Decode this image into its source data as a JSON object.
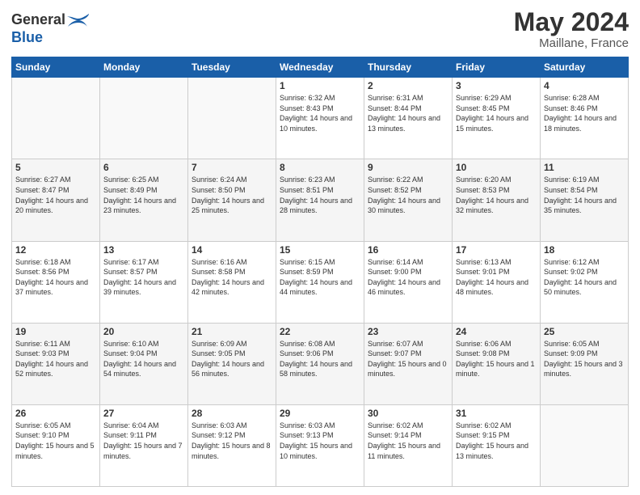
{
  "header": {
    "logo_line1": "General",
    "logo_line2": "Blue",
    "month_year": "May 2024",
    "location": "Maillane, France"
  },
  "days_of_week": [
    "Sunday",
    "Monday",
    "Tuesday",
    "Wednesday",
    "Thursday",
    "Friday",
    "Saturday"
  ],
  "weeks": [
    [
      {
        "day": "",
        "sunrise": "",
        "sunset": "",
        "daylight": ""
      },
      {
        "day": "",
        "sunrise": "",
        "sunset": "",
        "daylight": ""
      },
      {
        "day": "",
        "sunrise": "",
        "sunset": "",
        "daylight": ""
      },
      {
        "day": "1",
        "sunrise": "Sunrise: 6:32 AM",
        "sunset": "Sunset: 8:43 PM",
        "daylight": "Daylight: 14 hours and 10 minutes."
      },
      {
        "day": "2",
        "sunrise": "Sunrise: 6:31 AM",
        "sunset": "Sunset: 8:44 PM",
        "daylight": "Daylight: 14 hours and 13 minutes."
      },
      {
        "day": "3",
        "sunrise": "Sunrise: 6:29 AM",
        "sunset": "Sunset: 8:45 PM",
        "daylight": "Daylight: 14 hours and 15 minutes."
      },
      {
        "day": "4",
        "sunrise": "Sunrise: 6:28 AM",
        "sunset": "Sunset: 8:46 PM",
        "daylight": "Daylight: 14 hours and 18 minutes."
      }
    ],
    [
      {
        "day": "5",
        "sunrise": "Sunrise: 6:27 AM",
        "sunset": "Sunset: 8:47 PM",
        "daylight": "Daylight: 14 hours and 20 minutes."
      },
      {
        "day": "6",
        "sunrise": "Sunrise: 6:25 AM",
        "sunset": "Sunset: 8:49 PM",
        "daylight": "Daylight: 14 hours and 23 minutes."
      },
      {
        "day": "7",
        "sunrise": "Sunrise: 6:24 AM",
        "sunset": "Sunset: 8:50 PM",
        "daylight": "Daylight: 14 hours and 25 minutes."
      },
      {
        "day": "8",
        "sunrise": "Sunrise: 6:23 AM",
        "sunset": "Sunset: 8:51 PM",
        "daylight": "Daylight: 14 hours and 28 minutes."
      },
      {
        "day": "9",
        "sunrise": "Sunrise: 6:22 AM",
        "sunset": "Sunset: 8:52 PM",
        "daylight": "Daylight: 14 hours and 30 minutes."
      },
      {
        "day": "10",
        "sunrise": "Sunrise: 6:20 AM",
        "sunset": "Sunset: 8:53 PM",
        "daylight": "Daylight: 14 hours and 32 minutes."
      },
      {
        "day": "11",
        "sunrise": "Sunrise: 6:19 AM",
        "sunset": "Sunset: 8:54 PM",
        "daylight": "Daylight: 14 hours and 35 minutes."
      }
    ],
    [
      {
        "day": "12",
        "sunrise": "Sunrise: 6:18 AM",
        "sunset": "Sunset: 8:56 PM",
        "daylight": "Daylight: 14 hours and 37 minutes."
      },
      {
        "day": "13",
        "sunrise": "Sunrise: 6:17 AM",
        "sunset": "Sunset: 8:57 PM",
        "daylight": "Daylight: 14 hours and 39 minutes."
      },
      {
        "day": "14",
        "sunrise": "Sunrise: 6:16 AM",
        "sunset": "Sunset: 8:58 PM",
        "daylight": "Daylight: 14 hours and 42 minutes."
      },
      {
        "day": "15",
        "sunrise": "Sunrise: 6:15 AM",
        "sunset": "Sunset: 8:59 PM",
        "daylight": "Daylight: 14 hours and 44 minutes."
      },
      {
        "day": "16",
        "sunrise": "Sunrise: 6:14 AM",
        "sunset": "Sunset: 9:00 PM",
        "daylight": "Daylight: 14 hours and 46 minutes."
      },
      {
        "day": "17",
        "sunrise": "Sunrise: 6:13 AM",
        "sunset": "Sunset: 9:01 PM",
        "daylight": "Daylight: 14 hours and 48 minutes."
      },
      {
        "day": "18",
        "sunrise": "Sunrise: 6:12 AM",
        "sunset": "Sunset: 9:02 PM",
        "daylight": "Daylight: 14 hours and 50 minutes."
      }
    ],
    [
      {
        "day": "19",
        "sunrise": "Sunrise: 6:11 AM",
        "sunset": "Sunset: 9:03 PM",
        "daylight": "Daylight: 14 hours and 52 minutes."
      },
      {
        "day": "20",
        "sunrise": "Sunrise: 6:10 AM",
        "sunset": "Sunset: 9:04 PM",
        "daylight": "Daylight: 14 hours and 54 minutes."
      },
      {
        "day": "21",
        "sunrise": "Sunrise: 6:09 AM",
        "sunset": "Sunset: 9:05 PM",
        "daylight": "Daylight: 14 hours and 56 minutes."
      },
      {
        "day": "22",
        "sunrise": "Sunrise: 6:08 AM",
        "sunset": "Sunset: 9:06 PM",
        "daylight": "Daylight: 14 hours and 58 minutes."
      },
      {
        "day": "23",
        "sunrise": "Sunrise: 6:07 AM",
        "sunset": "Sunset: 9:07 PM",
        "daylight": "Daylight: 15 hours and 0 minutes."
      },
      {
        "day": "24",
        "sunrise": "Sunrise: 6:06 AM",
        "sunset": "Sunset: 9:08 PM",
        "daylight": "Daylight: 15 hours and 1 minute."
      },
      {
        "day": "25",
        "sunrise": "Sunrise: 6:05 AM",
        "sunset": "Sunset: 9:09 PM",
        "daylight": "Daylight: 15 hours and 3 minutes."
      }
    ],
    [
      {
        "day": "26",
        "sunrise": "Sunrise: 6:05 AM",
        "sunset": "Sunset: 9:10 PM",
        "daylight": "Daylight: 15 hours and 5 minutes."
      },
      {
        "day": "27",
        "sunrise": "Sunrise: 6:04 AM",
        "sunset": "Sunset: 9:11 PM",
        "daylight": "Daylight: 15 hours and 7 minutes."
      },
      {
        "day": "28",
        "sunrise": "Sunrise: 6:03 AM",
        "sunset": "Sunset: 9:12 PM",
        "daylight": "Daylight: 15 hours and 8 minutes."
      },
      {
        "day": "29",
        "sunrise": "Sunrise: 6:03 AM",
        "sunset": "Sunset: 9:13 PM",
        "daylight": "Daylight: 15 hours and 10 minutes."
      },
      {
        "day": "30",
        "sunrise": "Sunrise: 6:02 AM",
        "sunset": "Sunset: 9:14 PM",
        "daylight": "Daylight: 15 hours and 11 minutes."
      },
      {
        "day": "31",
        "sunrise": "Sunrise: 6:02 AM",
        "sunset": "Sunset: 9:15 PM",
        "daylight": "Daylight: 15 hours and 13 minutes."
      },
      {
        "day": "",
        "sunrise": "",
        "sunset": "",
        "daylight": ""
      }
    ]
  ],
  "accent_color": "#1a5fa8"
}
